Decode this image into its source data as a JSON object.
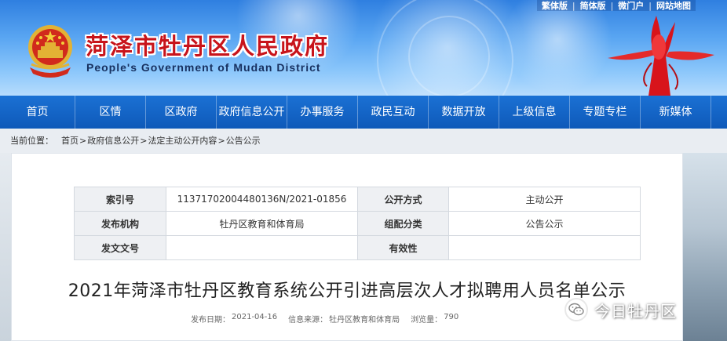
{
  "top_links": [
    "繁体版",
    "简体版",
    "微门户",
    "网站地图"
  ],
  "site": {
    "title_cn": "菏泽市牡丹区人民政府",
    "title_en": "People's Government of Mudan District"
  },
  "nav": [
    "首页",
    "区情",
    "区政府",
    "政府信息公开",
    "办事服务",
    "政民互动",
    "数据开放",
    "上级信息",
    "专题专栏",
    "新媒体"
  ],
  "breadcrumb": {
    "label": "当前位置：",
    "items": [
      "首页",
      "政府信息公开",
      "法定主动公开内容",
      "公告公示"
    ]
  },
  "meta": {
    "index_label": "索引号",
    "index_value": "11371702004480136N/2021-01856",
    "open_mode_label": "公开方式",
    "open_mode_value": "主动公开",
    "publisher_label": "发布机构",
    "publisher_value": "牡丹区教育和体育局",
    "category_label": "组配分类",
    "category_value": "公告公示",
    "doc_no_label": "发文文号",
    "doc_no_value": "",
    "validity_label": "有效性",
    "validity_value": ""
  },
  "document": {
    "title": "2021年菏泽市牡丹区教育系统公开引进高层次人才拟聘用人员名单公示",
    "date_label": "发布日期：",
    "date": "2021-04-16",
    "source_label": "信息来源：",
    "source": "牡丹区教育和体育局",
    "views_label": "浏览量：",
    "views": "790"
  },
  "watermark": {
    "text": "今日牡丹区",
    "icon": "wechat-icon"
  },
  "colors": {
    "nav_bg": "#0e59b9",
    "title_red": "#c8141b"
  }
}
